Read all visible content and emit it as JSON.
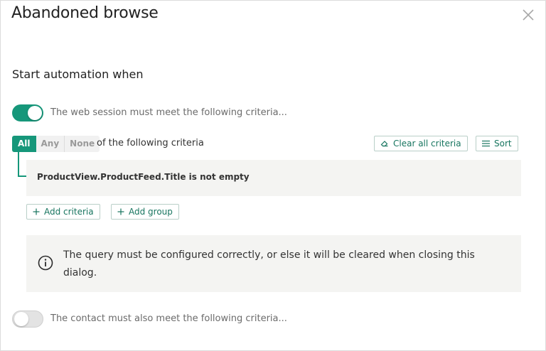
{
  "dialog": {
    "title": "Abandoned browse",
    "close_icon": "close-icon"
  },
  "section": {
    "title": "Start automation when"
  },
  "session_toggle": {
    "state": "on",
    "label": "The web session must meet the following criteria..."
  },
  "match_mode": {
    "options": [
      "All",
      "Any",
      "None"
    ],
    "selected": "All",
    "suffix": "of the following criteria"
  },
  "toolbar": {
    "clear_label": "Clear all criteria",
    "clear_icon": "eraser-icon",
    "sort_label": "Sort",
    "sort_icon": "lines-icon"
  },
  "criteria": {
    "rules": [
      "ProductView.ProductFeed.Title is not empty"
    ],
    "add_criteria_label": "Add criteria",
    "add_group_label": "Add group"
  },
  "info": {
    "icon": "info-icon",
    "message": "The query must be configured correctly, or else it will be cleared when closing this dialog."
  },
  "contact_toggle": {
    "state": "off",
    "label": "The contact must also meet the following criteria..."
  },
  "colors": {
    "accent": "#16977a",
    "panel": "#f4f4f2"
  }
}
